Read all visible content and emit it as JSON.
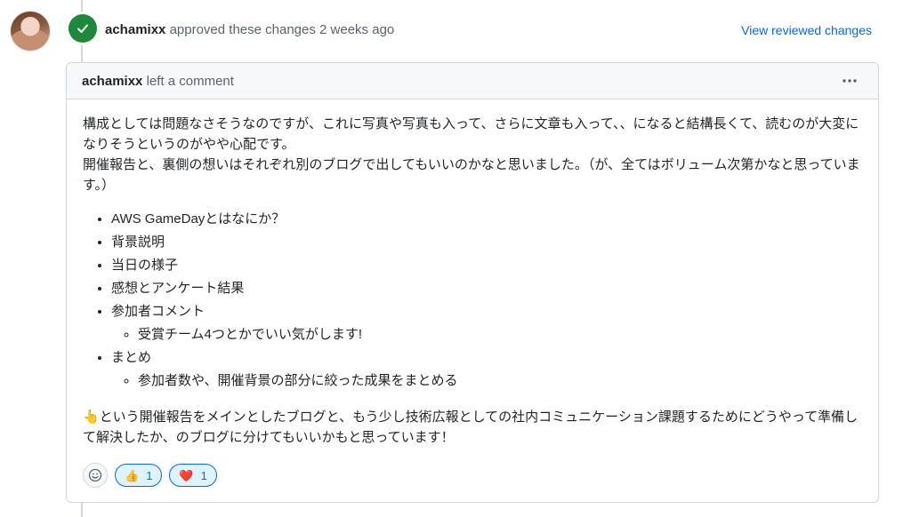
{
  "event": {
    "author": "achamixx",
    "action": "approved these changes",
    "time": "2 weeks ago",
    "view_changes": "View reviewed changes"
  },
  "comment": {
    "author": "achamixx",
    "action": "left a comment",
    "paragraph1": "構成としては問題なさそうなのですが、これに写真や写真も入って、さらに文章も入って、、になると結構長くて、読むのが大変になりそうというのがやや心配です。",
    "paragraph2": "開催報告と、裏側の想いはそれぞれ別のブログで出してもいいのかなと思いました。（が、全てはボリューム次第かなと思っています。）",
    "list": {
      "item1": "AWS GameDayとはなにか？",
      "item2": "背景説明",
      "item3": "当日の様子",
      "item4": "感想とアンケート結果",
      "item5": "参加者コメント",
      "item5_sub": "受賞チーム4つとかでいい気がします!",
      "item6": "まとめ",
      "item6_sub": "参加者数や、開催背景の部分に絞った成果をまとめる"
    },
    "closing": "👆という開催報告をメインとしたブログと、もう少し技術広報としての社内コミュニケーション課題するためにどうやって準備して解決したか、のブログに分けてもいいかもと思っています！"
  },
  "reactions": [
    {
      "emoji": "👍",
      "count": "1"
    },
    {
      "emoji": "❤️",
      "count": "1"
    }
  ],
  "colors": {
    "approved": "#1f883d",
    "link": "#0969da",
    "border": "#d0d7de",
    "header_bg": "#f6f8fa"
  },
  "icons": {
    "badge": "check-icon",
    "menu": "kebab-horizontal-icon",
    "add_reaction": "smiley-icon"
  }
}
